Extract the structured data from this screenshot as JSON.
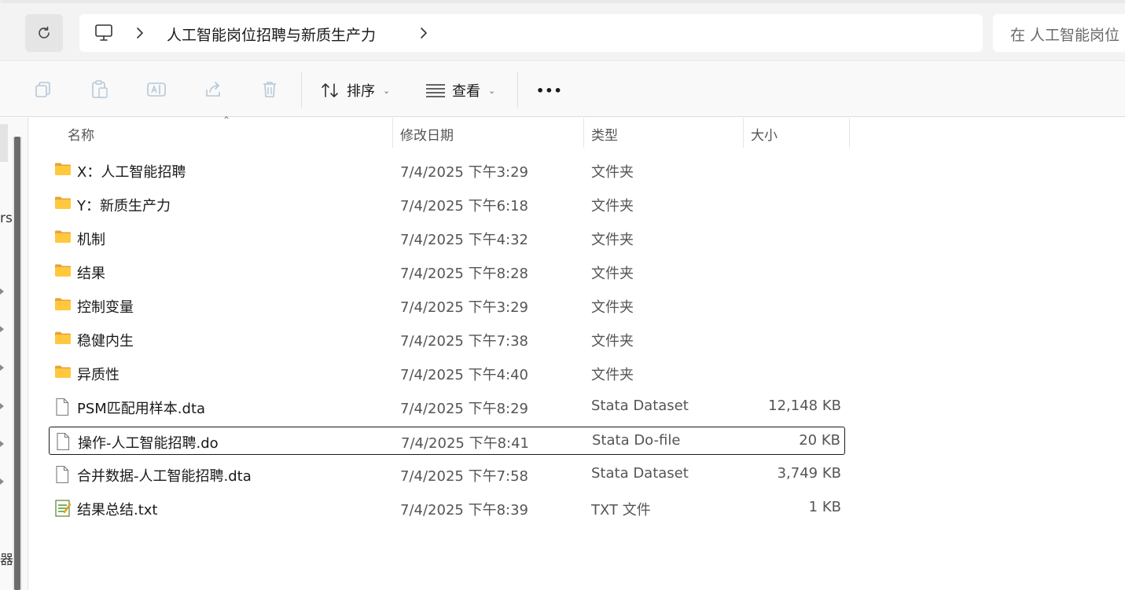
{
  "address": {
    "location_icon": "computer-icon",
    "breadcrumb": "人工智能岗位招聘与新质生产力",
    "search_placeholder": "在 人工智能岗位"
  },
  "toolbar": {
    "copy": "copy-icon",
    "paste": "paste-icon",
    "rename": "rename-icon",
    "share": "share-icon",
    "delete": "delete-icon",
    "sort_label": "排序",
    "view_label": "查看",
    "more_label": "•••"
  },
  "nav_fragments": [
    "rs",
    "器"
  ],
  "columns": {
    "name": "名称",
    "modified": "修改日期",
    "type": "类型",
    "size": "大小"
  },
  "files": [
    {
      "name": "X：人工智能招聘",
      "date": "7/4/2025 下午3:29",
      "type": "文件夹",
      "size": "",
      "icon": "folder-icon"
    },
    {
      "name": "Y：新质生产力",
      "date": "7/4/2025 下午6:18",
      "type": "文件夹",
      "size": "",
      "icon": "folder-icon"
    },
    {
      "name": "机制",
      "date": "7/4/2025 下午4:32",
      "type": "文件夹",
      "size": "",
      "icon": "folder-icon"
    },
    {
      "name": "结果",
      "date": "7/4/2025 下午8:28",
      "type": "文件夹",
      "size": "",
      "icon": "folder-icon"
    },
    {
      "name": "控制变量",
      "date": "7/4/2025 下午3:29",
      "type": "文件夹",
      "size": "",
      "icon": "folder-icon"
    },
    {
      "name": "稳健内生",
      "date": "7/4/2025 下午7:38",
      "type": "文件夹",
      "size": "",
      "icon": "folder-icon"
    },
    {
      "name": "异质性",
      "date": "7/4/2025 下午4:40",
      "type": "文件夹",
      "size": "",
      "icon": "folder-icon"
    },
    {
      "name": "PSM匹配用样本.dta",
      "date": "7/4/2025 下午8:29",
      "type": "Stata Dataset",
      "size": "12,148 KB",
      "icon": "file-icon"
    },
    {
      "name": "操作-人工智能招聘.do",
      "date": "7/4/2025 下午8:41",
      "type": "Stata Do-file",
      "size": "20 KB",
      "icon": "file-icon",
      "selected": true
    },
    {
      "name": "合并数据-人工智能招聘.dta",
      "date": "7/4/2025 下午7:58",
      "type": "Stata Dataset",
      "size": "3,749 KB",
      "icon": "file-icon"
    },
    {
      "name": "结果总结.txt",
      "date": "7/4/2025 下午8:39",
      "type": "TXT 文件",
      "size": "1 KB",
      "icon": "text-file-icon"
    }
  ]
}
